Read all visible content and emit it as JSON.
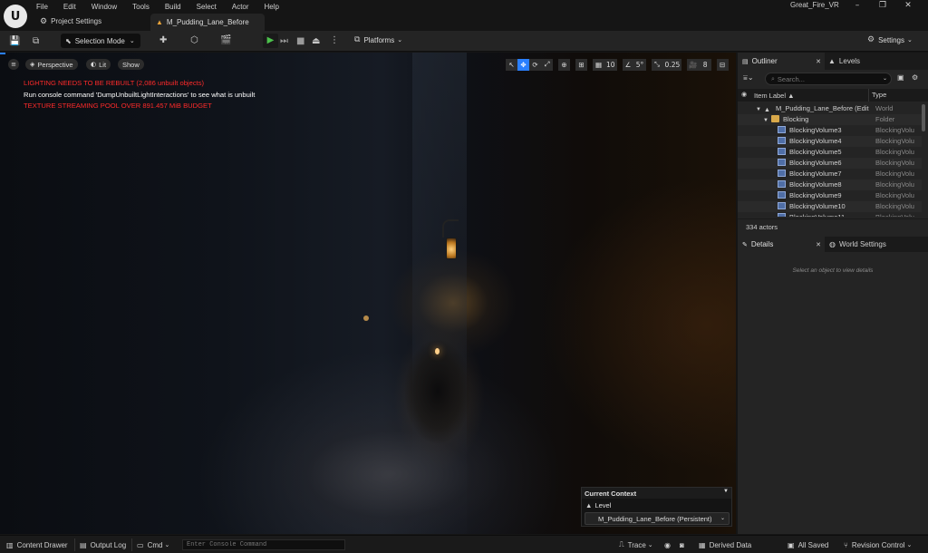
{
  "app": {
    "logo_text": "U",
    "project_name": "Great_Fire_VR",
    "menu": [
      "File",
      "Edit",
      "Window",
      "Tools",
      "Build",
      "Select",
      "Actor",
      "Help"
    ],
    "project_settings_tab": "Project Settings",
    "level_tab": "M_Pudding_Lane_Before",
    "window_controls": {
      "minimize": "–",
      "maximize": "❐",
      "close": "✕"
    }
  },
  "toolbar": {
    "save_icon": "💾",
    "source_control_icon": "⧉",
    "mode_label": "Selection Mode",
    "mode_icon": "⬉",
    "add_icon": "✚",
    "blueprint_icon": "⬡",
    "cinematics_icon": "🎬",
    "play_icon": "▶",
    "advance_frame_icon": "⏭",
    "stop_icon": "■",
    "eject_icon": "⏏",
    "more_icon": "⋮",
    "platforms_label": "Platforms",
    "platforms_icon": "⧉",
    "settings_label": "Settings",
    "settings_icon": "⚙"
  },
  "viewport": {
    "menu_icon": "≡",
    "view_mode": "Perspective",
    "lighting_mode": "Lit",
    "show_label": "Show",
    "tools": {
      "select_icon": "↖",
      "move_icon": "✥",
      "rotate_icon": "⟳",
      "scale_icon": "⤢",
      "world_icon": "⊕",
      "surface_snap_icon": "⊞",
      "grid_icon": "▦",
      "grid_value": "10",
      "rotation_icon": "∠",
      "rotation_value": "5°",
      "scale_snap_icon": "⤡",
      "scale_value": "0.25",
      "camera_icon": "🎥",
      "camera_speed": "8",
      "layout_icon": "⊟"
    },
    "messages": {
      "lighting": "LIGHTING NEEDS TO BE REBUILT (2,086 unbuilt objects)",
      "console_hint": "Run console command 'DumpUnbuiltLightInteractions' to see what is unbuilt",
      "texture": "TEXTURE STREAMING POOL OVER 891.457 MiB BUDGET"
    },
    "context": {
      "title": "Current Context",
      "level_label": "Level",
      "level_value": "M_Pudding_Lane_Before (Persistent)"
    }
  },
  "outliner": {
    "tab_label": "Outliner",
    "levels_tab": "Levels",
    "search_placeholder": "Search...",
    "col_label": "Item Label ▲",
    "col_type": "Type",
    "rows": [
      {
        "label": "M_Pudding_Lane_Before (Edit",
        "type": "World",
        "kind": "world",
        "indent": 20
      },
      {
        "label": "Blocking",
        "type": "Folder",
        "kind": "folder",
        "indent": 28
      },
      {
        "label": "BlockingVolume3",
        "type": "BlockingVolu",
        "kind": "vol",
        "indent": 44
      },
      {
        "label": "BlockingVolume4",
        "type": "BlockingVolu",
        "kind": "vol",
        "indent": 44
      },
      {
        "label": "BlockingVolume5",
        "type": "BlockingVolu",
        "kind": "vol",
        "indent": 44
      },
      {
        "label": "BlockingVolume6",
        "type": "BlockingVolu",
        "kind": "vol",
        "indent": 44
      },
      {
        "label": "BlockingVolume7",
        "type": "BlockingVolu",
        "kind": "vol",
        "indent": 44
      },
      {
        "label": "BlockingVolume8",
        "type": "BlockingVolu",
        "kind": "vol",
        "indent": 44
      },
      {
        "label": "BlockingVolume9",
        "type": "BlockingVolu",
        "kind": "vol",
        "indent": 44
      },
      {
        "label": "BlockingVolume10",
        "type": "BlockingVolu",
        "kind": "vol",
        "indent": 44
      },
      {
        "label": "BlockingVolume11",
        "type": "BlockingVolu",
        "kind": "vol",
        "indent": 44
      }
    ],
    "actor_count": "334 actors"
  },
  "details": {
    "tab_label": "Details",
    "world_settings_tab": "World Settings",
    "empty_text": "Select an object to view details"
  },
  "statusbar": {
    "content_drawer": "Content Drawer",
    "output_log": "Output Log",
    "cmd_label": "Cmd",
    "console_placeholder": "Enter Console Command",
    "trace": "Trace",
    "derived_data": "Derived Data",
    "all_saved": "All Saved",
    "revision_control": "Revision Control"
  },
  "colors": {
    "accent": "#2a7fff",
    "play_green": "#4cc24c",
    "warning_red": "#ff2a2a",
    "panel_bg": "#242424"
  }
}
